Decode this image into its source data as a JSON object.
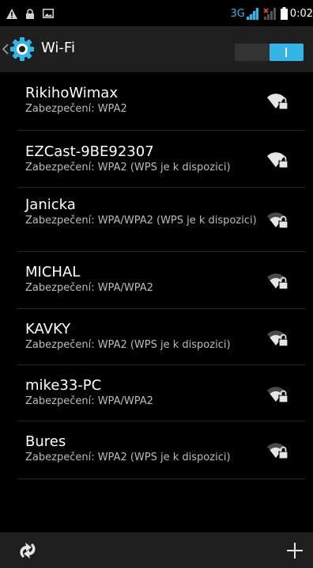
{
  "status_bar": {
    "left_icons": [
      "warning-icon",
      "lock-icon",
      "image-icon"
    ],
    "network_type": "3G",
    "time": "0:02",
    "accent_color": "#33b5e5"
  },
  "action_bar": {
    "title": "Wi-Fi",
    "app_icon": "settings-gear-icon",
    "toggle_on": true
  },
  "networks": [
    {
      "ssid": "RikihoWimax",
      "security": "Zabezpečení: WPA2",
      "signal_bars": 4,
      "secured": true
    },
    {
      "ssid": "EZCast-9BE92307",
      "security": "Zabezpečení: WPA2 (WPS je k dispozici)",
      "signal_bars": 4,
      "secured": true
    },
    {
      "ssid": "Janicka",
      "security": "Zabezpečení: WPA/WPA2 (WPS je k dispozici)",
      "signal_bars": 3,
      "secured": true
    },
    {
      "ssid": "MICHAL",
      "security": "Zabezpečení: WPA/WPA2",
      "signal_bars": 3,
      "secured": true
    },
    {
      "ssid": "KAVKY",
      "security": "Zabezpečení: WPA2 (WPS je k dispozici)",
      "signal_bars": 3,
      "secured": true
    },
    {
      "ssid": "mike33-PC",
      "security": "Zabezpečení: WPA/WPA2",
      "signal_bars": 3,
      "secured": true
    },
    {
      "ssid": "Bures",
      "security": "Zabezpečení: WPA2 (WPS je k dispozici)",
      "signal_bars": 3,
      "secured": true
    }
  ],
  "bottom_bar": {
    "left_icon": "wps-icon",
    "right_icon": "add-icon"
  }
}
